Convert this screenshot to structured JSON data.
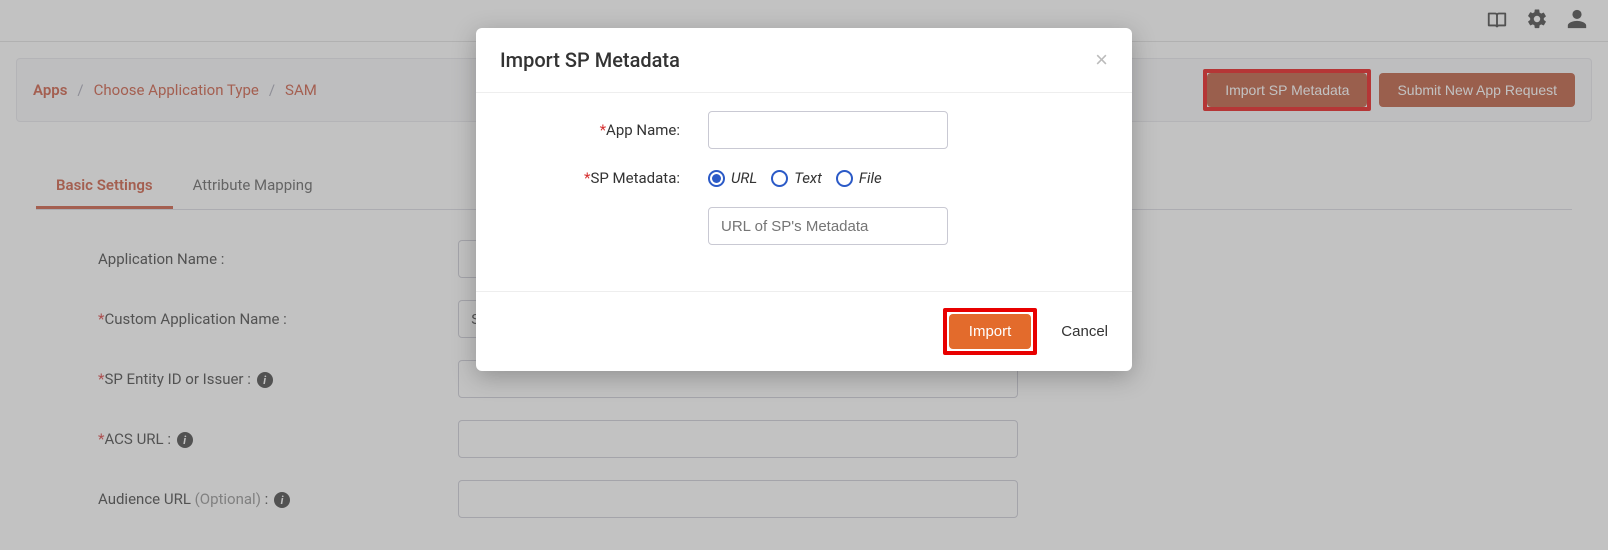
{
  "topbar_icons": {
    "book": "book-icon",
    "gear": "gear-icon",
    "user": "user-icon"
  },
  "breadcrumb": {
    "items": [
      "Apps",
      "Choose Application Type",
      "SAM"
    ]
  },
  "actions": {
    "import_metadata": "Import SP Metadata",
    "submit_request": "Submit New App Request"
  },
  "tabs": [
    {
      "label": "Basic Settings",
      "active": true
    },
    {
      "label": "Attribute Mapping",
      "active": false
    }
  ],
  "form": {
    "app_name_label": "Application Name :",
    "custom_app_label": "Custom Application Name :",
    "custom_app_value": "Salesforce",
    "sp_entity_label": "SP Entity ID or Issuer :",
    "acs_url_label": "ACS URL :",
    "audience_url_label": "Audience URL ",
    "audience_optional": "(Optional)",
    "audience_colon": " :"
  },
  "modal": {
    "title": "Import SP Metadata",
    "app_name_label": "App Name:",
    "sp_metadata_label": "SP Metadata:",
    "radio_url": "URL",
    "radio_text": "Text",
    "radio_file": "File",
    "url_placeholder": "URL of SP's Metadata",
    "import_btn": "Import",
    "cancel_btn": "Cancel"
  }
}
